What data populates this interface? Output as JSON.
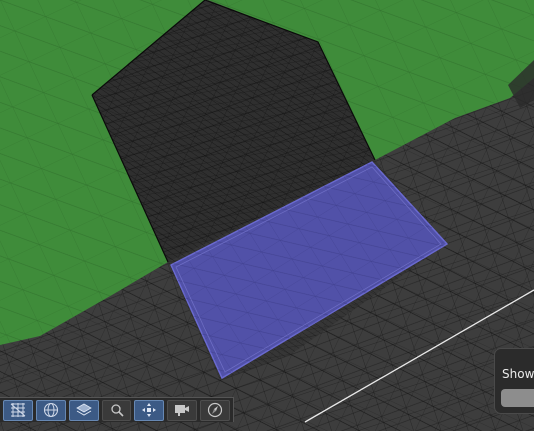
{
  "viewport": {
    "description_icon": "wireframe-3d-scene",
    "colors": {
      "background": "#3d3d3d",
      "terrain_green": "#3f8c3a",
      "selection_blue": "#5151a8",
      "wire": "#101010",
      "road_line": "#e8e8e8"
    }
  },
  "toolbar": {
    "buttons": [
      {
        "icon": "wireframe-mesh-icon",
        "active": true
      },
      {
        "icon": "globe-icon",
        "active": true
      },
      {
        "icon": "layers-icon",
        "active": true
      },
      {
        "icon": "magnifier-icon",
        "active": false
      },
      {
        "icon": "move-arrows-icon",
        "active": true
      },
      {
        "icon": "camera-icon",
        "active": false
      },
      {
        "icon": "compass-icon",
        "active": false
      }
    ]
  },
  "show_panel": {
    "label": "Show"
  }
}
